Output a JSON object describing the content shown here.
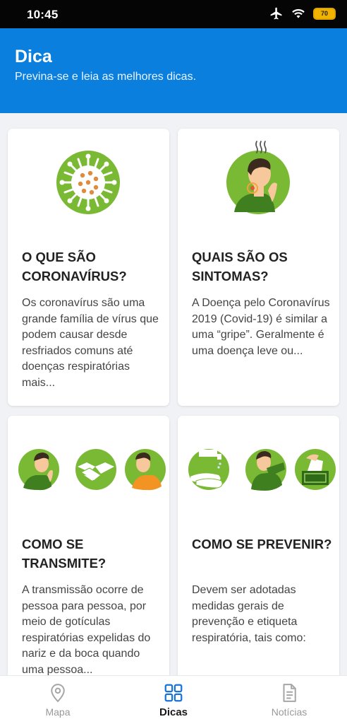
{
  "status_bar": {
    "time": "10:45",
    "battery": "70"
  },
  "header": {
    "title": "Dica",
    "subtitle": "Previna-se e leia as melhores dicas."
  },
  "cards": [
    {
      "title": "O QUE SÃO CORONAVÍRUS?",
      "text": "Os coronavírus são uma grande família de vírus que podem causar desde resfriados comuns até doenças respiratórias mais..."
    },
    {
      "title": "QUAIS SÃO OS SINTOMAS?",
      "text": "A Doença pelo Coronavírus 2019 (Covid-19) é similar a uma “gripe”. Geralmente é uma doença leve ou..."
    },
    {
      "title": "COMO SE TRANSMITE?",
      "text": "A transmissão ocorre de pessoa para pessoa, por meio de gotículas respiratórias expelidas do nariz e da boca quando uma pessoa..."
    },
    {
      "title": "COMO SE PREVENIR?",
      "text": "Devem ser adotadas medidas gerais de prevenção e etiqueta respiratória, tais como:"
    }
  ],
  "bottom_nav": [
    {
      "label": "Mapa",
      "icon": "map-pin-icon"
    },
    {
      "label": "Dicas",
      "icon": "grid-icon"
    },
    {
      "label": "Notícias",
      "icon": "document-icon"
    }
  ],
  "colors": {
    "primary": "#0a7fde",
    "illustration_green": "#7ab934",
    "dark_green": "#3f7f1f",
    "skin": "#f6c89b"
  }
}
